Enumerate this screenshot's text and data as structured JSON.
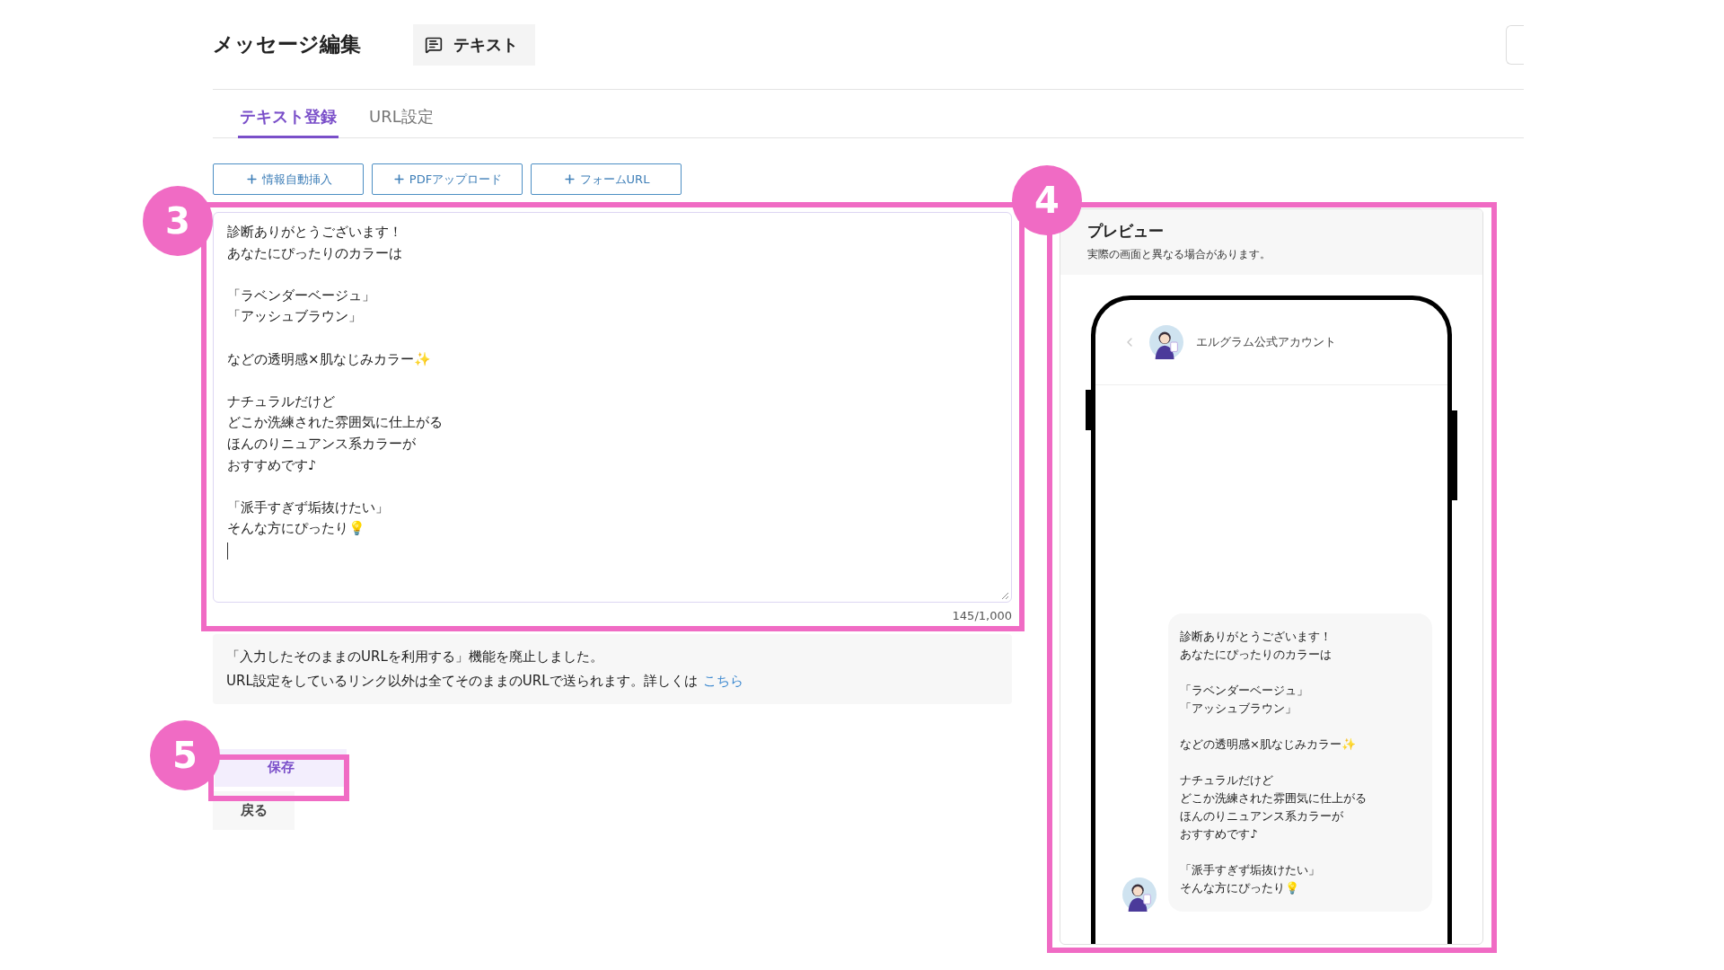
{
  "header": {
    "title": "メッセージ編集",
    "type_chip": "テキスト"
  },
  "tabs": [
    {
      "label": "テキスト登録",
      "selected": true
    },
    {
      "label": "URL設定",
      "selected": false
    }
  ],
  "insert_buttons": [
    {
      "label": "情報自動挿入"
    },
    {
      "label": "PDFアップロード"
    },
    {
      "label": "フォームURL"
    }
  ],
  "editor": {
    "paragraphs": [
      [
        "診断ありがとうございます！",
        "あなたにぴったりのカラーは"
      ],
      [
        "「ラベンダーベージュ」",
        "「アッシュブラウン」"
      ],
      [
        "などの透明感×肌なじみカラー✨"
      ],
      [
        "ナチュラルだけど",
        "どこか洗練された雰囲気に仕上がる",
        "ほんのりニュアンス系カラーが",
        "おすすめです♪"
      ],
      [
        "「派手すぎず垢抜けたい」",
        "そんな方にぴったり💡"
      ]
    ],
    "counter": "145/1,000"
  },
  "notice": {
    "line_1": "「入力したそのままのURLを利用する」機能を廃止しました。",
    "line_2": "URL設定をしているリンク以外は全てそのままのURLで送られます。詳しくは",
    "link": "こちら"
  },
  "actions": [
    {
      "label": "保存",
      "kind": "primary"
    },
    {
      "label": "戻る",
      "kind": "secondary"
    }
  ],
  "preview": {
    "title": "プレビュー",
    "note": "実際の画面と異なる場合があります。",
    "account_name": "エルグラム公式アカウント",
    "paragraphs": [
      [
        "診断ありがとうございます！",
        "あなたにぴったりのカラーは"
      ],
      [
        "「ラベンダーベージュ」",
        "「アッシュブラウン」"
      ],
      [
        "などの透明感×肌なじみカラー✨"
      ],
      [
        "ナチュラルだけど",
        "どこか洗練された雰囲気に仕上がる",
        "ほんのりニュアンス系カラーが",
        "おすすめです♪"
      ],
      [
        "「派手すぎず垢抜けたい」",
        "そんな方にぴったり💡"
      ]
    ]
  },
  "annotations": [
    {
      "label": "3"
    },
    {
      "label": "4"
    },
    {
      "label": "5"
    }
  ]
}
